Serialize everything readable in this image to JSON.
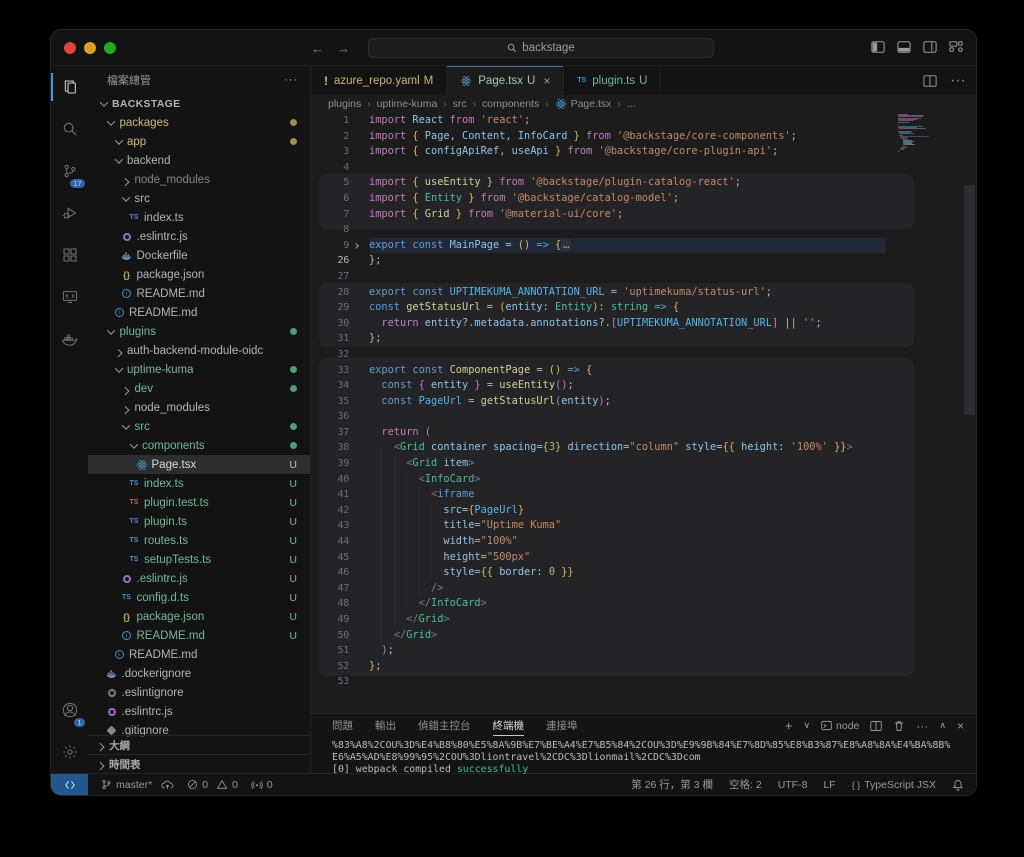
{
  "titlebar": {
    "search": "backstage"
  },
  "activity_bar": {
    "scm_badge": "17",
    "account_badge": "1"
  },
  "sidebar": {
    "header": "檔案總管",
    "sections": [
      "大綱",
      "時間表"
    ],
    "tree": [
      {
        "l": "BACKSTAGE",
        "d": 0,
        "ch": "d",
        "root": true
      },
      {
        "l": "packages",
        "d": 1,
        "ch": "d",
        "col": "m",
        "b": "dotm"
      },
      {
        "l": "app",
        "d": 2,
        "ch": "d",
        "col": "m",
        "b": "dotm"
      },
      {
        "l": "backend",
        "d": 2,
        "ch": "d",
        "col": "n"
      },
      {
        "l": "node_modules",
        "d": 3,
        "ch": "r",
        "col": "dim"
      },
      {
        "l": "src",
        "d": 3,
        "ch": "d",
        "col": "n"
      },
      {
        "l": "index.ts",
        "d": 4,
        "i": "ts",
        "col": "n"
      },
      {
        "l": ".eslintrc.js",
        "d": 3,
        "i": "esl",
        "col": "n"
      },
      {
        "l": "Dockerfile",
        "d": 3,
        "i": "dock",
        "col": "n"
      },
      {
        "l": "package.json",
        "d": 3,
        "i": "json",
        "col": "n"
      },
      {
        "l": "README.md",
        "d": 3,
        "i": "info",
        "col": "n"
      },
      {
        "l": "README.md",
        "d": 2,
        "i": "info",
        "col": "n"
      },
      {
        "l": "plugins",
        "d": 1,
        "ch": "d",
        "col": "u",
        "b": "dotu"
      },
      {
        "l": "auth-backend-module-oidc",
        "d": 2,
        "ch": "r",
        "col": "n"
      },
      {
        "l": "uptime-kuma",
        "d": 2,
        "ch": "d",
        "col": "u",
        "b": "dotu"
      },
      {
        "l": "dev",
        "d": 3,
        "ch": "r",
        "col": "u",
        "b": "dotu"
      },
      {
        "l": "node_modules",
        "d": 3,
        "ch": "r",
        "col": "n"
      },
      {
        "l": "src",
        "d": 3,
        "ch": "d",
        "col": "u",
        "b": "dotu"
      },
      {
        "l": "components",
        "d": 4,
        "ch": "d",
        "col": "u",
        "b": "dotu"
      },
      {
        "l": "Page.tsx",
        "d": 5,
        "i": "react",
        "col": "sel",
        "b": "U",
        "sel": true
      },
      {
        "l": "index.ts",
        "d": 4,
        "i": "ts",
        "col": "u",
        "b": "U"
      },
      {
        "l": "plugin.test.ts",
        "d": 4,
        "i": "tst",
        "col": "u",
        "b": "U"
      },
      {
        "l": "plugin.ts",
        "d": 4,
        "i": "ts",
        "col": "u",
        "b": "U"
      },
      {
        "l": "routes.ts",
        "d": 4,
        "i": "ts",
        "col": "u",
        "b": "U"
      },
      {
        "l": "setupTests.ts",
        "d": 4,
        "i": "ts",
        "col": "u",
        "b": "U"
      },
      {
        "l": ".eslintrc.js",
        "d": 3,
        "i": "esl",
        "col": "u",
        "b": "U"
      },
      {
        "l": "config.d.ts",
        "d": 3,
        "i": "ts",
        "col": "u",
        "b": "U"
      },
      {
        "l": "package.json",
        "d": 3,
        "i": "json",
        "col": "u",
        "b": "U"
      },
      {
        "l": "README.md",
        "d": 3,
        "i": "info",
        "col": "u",
        "b": "U"
      },
      {
        "l": "README.md",
        "d": 2,
        "i": "info",
        "col": "n"
      },
      {
        "l": ".dockerignore",
        "d": 1,
        "i": "dock",
        "col": "n"
      },
      {
        "l": ".eslintignore",
        "d": 1,
        "i": "ring",
        "col": "n"
      },
      {
        "l": ".eslintrc.js",
        "d": 1,
        "i": "esl",
        "col": "n"
      },
      {
        "l": ".gitignore",
        "d": 1,
        "i": "dia",
        "col": "n"
      }
    ]
  },
  "tabs": [
    {
      "label": "azure_repo.yaml",
      "mark": "M",
      "icon": "warn",
      "cls": "t-warn"
    },
    {
      "label": "Page.tsx",
      "mark": "U",
      "icon": "react",
      "cls": "t-act",
      "active": true,
      "close": "×"
    },
    {
      "label": "plugin.ts",
      "mark": "U",
      "icon": "ts",
      "cls": "t-green"
    }
  ],
  "breadcrumbs": [
    "plugins",
    "uptime-kuma",
    "src",
    "components",
    "Page.tsx",
    "..."
  ],
  "editor": {
    "lines": [
      {
        "n": 1,
        "t": [
          [
            "import",
            "k"
          ],
          [
            " React",
            "v"
          ],
          [
            " from",
            "k"
          ],
          [
            " 'react'",
            "s"
          ],
          [
            ";",
            "p"
          ]
        ]
      },
      {
        "n": 2,
        "t": [
          [
            "import",
            "k"
          ],
          [
            " {",
            "b"
          ],
          [
            " Page",
            "v"
          ],
          [
            ",",
            "p"
          ],
          [
            " Content",
            "v"
          ],
          [
            ",",
            "p"
          ],
          [
            " InfoCard",
            "v"
          ],
          [
            " }",
            "b"
          ],
          [
            " from",
            "k"
          ],
          [
            " '@backstage/core-components'",
            "s"
          ],
          [
            ";",
            "p"
          ]
        ]
      },
      {
        "n": 3,
        "t": [
          [
            "import",
            "k"
          ],
          [
            " {",
            "b"
          ],
          [
            " configApiRef",
            "v"
          ],
          [
            ",",
            "p"
          ],
          [
            " useApi",
            "v"
          ],
          [
            " }",
            "b"
          ],
          [
            " from",
            "k"
          ],
          [
            " '@backstage/core-plugin-api'",
            "s"
          ],
          [
            ";",
            "p"
          ]
        ]
      },
      {
        "n": 4,
        "t": []
      },
      {
        "n": 5,
        "t": [
          [
            "import",
            "k"
          ],
          [
            " {",
            "b"
          ],
          [
            " useEntity",
            "f"
          ],
          [
            " }",
            "b"
          ],
          [
            " from",
            "k"
          ],
          [
            " '@backstage/plugin-catalog-react'",
            "s"
          ],
          [
            ";",
            "p"
          ]
        ]
      },
      {
        "n": 6,
        "t": [
          [
            "import",
            "k"
          ],
          [
            " {",
            "b"
          ],
          [
            " Entity",
            "t"
          ],
          [
            " }",
            "b"
          ],
          [
            " from",
            "k"
          ],
          [
            " '@backstage/catalog-model'",
            "s"
          ],
          [
            ";",
            "p"
          ]
        ]
      },
      {
        "n": 7,
        "t": [
          [
            "import",
            "k"
          ],
          [
            " {",
            "b"
          ],
          [
            " Grid",
            "f"
          ],
          [
            " }",
            "b"
          ],
          [
            " from",
            "k"
          ],
          [
            " '@material-ui/core'",
            "s"
          ],
          [
            ";",
            "p"
          ]
        ]
      },
      {
        "n": 8,
        "t": []
      },
      {
        "n": 9,
        "fold": true,
        "t": [
          [
            "export",
            "e"
          ],
          [
            " const",
            "e"
          ],
          [
            " MainPage",
            "v"
          ],
          [
            " =",
            "p"
          ],
          [
            " (",
            "b"
          ],
          [
            ")",
            "b"
          ],
          [
            " ",
            "p"
          ],
          [
            "=>",
            "e"
          ],
          [
            " {",
            "b"
          ],
          [
            "…",
            "fold"
          ]
        ]
      },
      {
        "n": 26,
        "t": [
          [
            "}",
            "b"
          ],
          [
            ";",
            "p"
          ]
        ]
      },
      {
        "n": 27,
        "t": []
      },
      {
        "n": 28,
        "t": [
          [
            "export",
            "e"
          ],
          [
            " const",
            "e"
          ],
          [
            " UPTIMEKUMA_ANNOTATION_URL",
            "c"
          ],
          [
            " =",
            "p"
          ],
          [
            " 'uptimekuma/status-url'",
            "s"
          ],
          [
            ";",
            "p"
          ]
        ]
      },
      {
        "n": 29,
        "t": [
          [
            "const",
            "e"
          ],
          [
            " getStatusUrl",
            "f"
          ],
          [
            " =",
            "p"
          ],
          [
            " (",
            "b"
          ],
          [
            "entity",
            "v"
          ],
          [
            ":",
            "p"
          ],
          [
            " Entity",
            "t"
          ],
          [
            ")",
            "b"
          ],
          [
            ":",
            "p"
          ],
          [
            " string",
            "t"
          ],
          [
            " ",
            "p"
          ],
          [
            "=>",
            "e"
          ],
          [
            " {",
            "b"
          ]
        ]
      },
      {
        "n": 30,
        "t": [
          [
            "  ",
            "p"
          ],
          [
            "return",
            "k"
          ],
          [
            " entity",
            "v"
          ],
          [
            "?.",
            "p"
          ],
          [
            "metadata",
            "v"
          ],
          [
            ".",
            "p"
          ],
          [
            "annotations",
            "v"
          ],
          [
            "?.",
            "p"
          ],
          [
            "[",
            "o"
          ],
          [
            "UPTIMEKUMA_ANNOTATION_URL",
            "c"
          ],
          [
            "]",
            "o"
          ],
          [
            " ||",
            "p"
          ],
          [
            " ''",
            "s"
          ],
          [
            ";",
            "p"
          ]
        ]
      },
      {
        "n": 31,
        "t": [
          [
            "}",
            "b"
          ],
          [
            ";",
            "p"
          ]
        ]
      },
      {
        "n": 32,
        "t": []
      },
      {
        "n": 33,
        "t": [
          [
            "export",
            "e"
          ],
          [
            " const",
            "e"
          ],
          [
            " ComponentPage",
            "f"
          ],
          [
            " =",
            "p"
          ],
          [
            " (",
            "b"
          ],
          [
            ")",
            "b"
          ],
          [
            " ",
            "p"
          ],
          [
            "=>",
            "e"
          ],
          [
            " {",
            "b"
          ]
        ]
      },
      {
        "n": 34,
        "t": [
          [
            "  ",
            "p"
          ],
          [
            "const",
            "e"
          ],
          [
            " {",
            "o"
          ],
          [
            " entity",
            "v"
          ],
          [
            " }",
            "o"
          ],
          [
            " =",
            "p"
          ],
          [
            " useEntity",
            "f"
          ],
          [
            "(",
            "o"
          ],
          [
            ")",
            "o"
          ],
          [
            ";",
            "p"
          ]
        ]
      },
      {
        "n": 35,
        "t": [
          [
            "  ",
            "p"
          ],
          [
            "const",
            "e"
          ],
          [
            " PageUrl",
            "c"
          ],
          [
            " =",
            "p"
          ],
          [
            " getStatusUrl",
            "f"
          ],
          [
            "(",
            "o"
          ],
          [
            "entity",
            "v"
          ],
          [
            ")",
            "o"
          ],
          [
            ";",
            "p"
          ]
        ]
      },
      {
        "n": 36,
        "t": []
      },
      {
        "n": 37,
        "t": [
          [
            "  ",
            "p"
          ],
          [
            "return",
            "k"
          ],
          [
            " (",
            "o"
          ]
        ]
      },
      {
        "n": 38,
        "t": [
          [
            "    ",
            "p"
          ],
          [
            "<",
            "g"
          ],
          [
            "Grid",
            "t"
          ],
          [
            " container",
            "v"
          ],
          [
            " spacing",
            "v"
          ],
          [
            "=",
            "p"
          ],
          [
            "{",
            "b"
          ],
          [
            "3",
            "n"
          ],
          [
            "}",
            "b"
          ],
          [
            " direction",
            "v"
          ],
          [
            "=",
            "p"
          ],
          [
            "\"column\"",
            "s"
          ],
          [
            " style",
            "v"
          ],
          [
            "=",
            "p"
          ],
          [
            "{{",
            "b"
          ],
          [
            " height",
            "v"
          ],
          [
            ":",
            "p"
          ],
          [
            " '100%'",
            "s"
          ],
          [
            " }}",
            "b"
          ],
          [
            ">",
            "g"
          ]
        ]
      },
      {
        "n": 39,
        "t": [
          [
            "      ",
            "p"
          ],
          [
            "<",
            "g"
          ],
          [
            "Grid",
            "t"
          ],
          [
            " item",
            "v"
          ],
          [
            ">",
            "g"
          ]
        ]
      },
      {
        "n": 40,
        "t": [
          [
            "        ",
            "p"
          ],
          [
            "<",
            "g"
          ],
          [
            "InfoCard",
            "t"
          ],
          [
            ">",
            "g"
          ]
        ]
      },
      {
        "n": 41,
        "t": [
          [
            "          ",
            "p"
          ],
          [
            "<",
            "g"
          ],
          [
            "iframe",
            "e"
          ]
        ]
      },
      {
        "n": 42,
        "t": [
          [
            "            ",
            "p"
          ],
          [
            "src",
            "v"
          ],
          [
            "=",
            "p"
          ],
          [
            "{",
            "b"
          ],
          [
            "PageUrl",
            "c"
          ],
          [
            "}",
            "b"
          ]
        ]
      },
      {
        "n": 43,
        "t": [
          [
            "            ",
            "p"
          ],
          [
            "title",
            "v"
          ],
          [
            "=",
            "p"
          ],
          [
            "\"Uptime Kuma\"",
            "s"
          ]
        ]
      },
      {
        "n": 44,
        "t": [
          [
            "            ",
            "p"
          ],
          [
            "width",
            "v"
          ],
          [
            "=",
            "p"
          ],
          [
            "\"100%\"",
            "s"
          ]
        ]
      },
      {
        "n": 45,
        "t": [
          [
            "            ",
            "p"
          ],
          [
            "height",
            "v"
          ],
          [
            "=",
            "p"
          ],
          [
            "\"500px\"",
            "s"
          ]
        ]
      },
      {
        "n": 46,
        "t": [
          [
            "            ",
            "p"
          ],
          [
            "style",
            "v"
          ],
          [
            "=",
            "p"
          ],
          [
            "{{",
            "b"
          ],
          [
            " border",
            "v"
          ],
          [
            ":",
            "p"
          ],
          [
            " 0",
            "n"
          ],
          [
            " }}",
            "b"
          ]
        ]
      },
      {
        "n": 47,
        "t": [
          [
            "          ",
            "p"
          ],
          [
            "/>",
            "g"
          ]
        ]
      },
      {
        "n": 48,
        "t": [
          [
            "        ",
            "p"
          ],
          [
            "</",
            "g"
          ],
          [
            "InfoCard",
            "t"
          ],
          [
            ">",
            "g"
          ]
        ]
      },
      {
        "n": 49,
        "t": [
          [
            "      ",
            "p"
          ],
          [
            "</",
            "g"
          ],
          [
            "Grid",
            "t"
          ],
          [
            ">",
            "g"
          ]
        ]
      },
      {
        "n": 50,
        "t": [
          [
            "    ",
            "p"
          ],
          [
            "</",
            "g"
          ],
          [
            "Grid",
            "t"
          ],
          [
            ">",
            "g"
          ]
        ]
      },
      {
        "n": 51,
        "t": [
          [
            "  ",
            "p"
          ],
          [
            ")",
            "o"
          ],
          [
            ";",
            "p"
          ]
        ]
      },
      {
        "n": 52,
        "t": [
          [
            "}",
            "b"
          ],
          [
            ";",
            "p"
          ]
        ]
      },
      {
        "n": 53,
        "t": []
      }
    ],
    "cursor_line": 26
  },
  "panel": {
    "tabs": [
      "問題",
      "輸出",
      "偵錯主控台",
      "終端機",
      "連接埠"
    ],
    "active_tab": "終端機",
    "terminal_name": "node",
    "lines": [
      [
        [
          "%83%A8%2COU%3D%E4%B8%80%E5%8A%9B%E7%BE%A4%E7%B5%84%2COU%3D%E9%9B%84%E7%8D%85%E8%B3%87%E8%A8%8A%E4%BA%8B%",
          "pl"
        ]
      ],
      [
        [
          "E6%A5%AD%E8%99%95%2COU%3Dliontravel%2CDC%3Dlionmail%2CDC%3Dcom",
          "pl"
        ]
      ],
      [
        [
          "[0] webpack compiled ",
          "pl"
        ],
        [
          "successfully",
          "ok"
        ]
      ]
    ]
  },
  "status_bar": {
    "branch": "master*",
    "errors": "0",
    "warnings": "0",
    "tx": "0",
    "line_col": "第 26 行，第 3 欄",
    "spaces": "空格: 2",
    "encoding": "UTF-8",
    "eol": "LF",
    "language": "TypeScript JSX"
  }
}
